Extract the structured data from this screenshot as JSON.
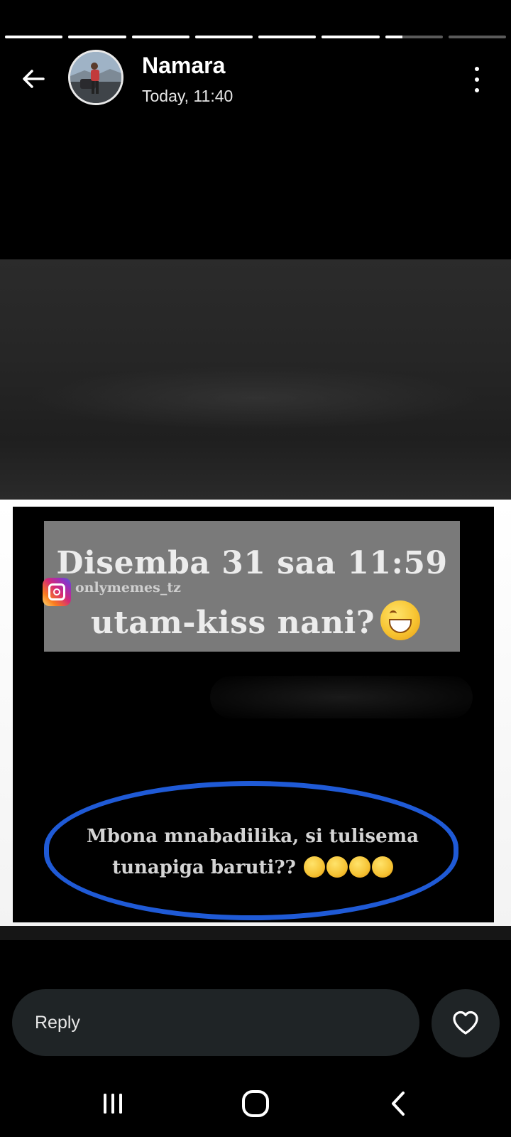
{
  "status": {
    "progress_segments": [
      1,
      1,
      1,
      1,
      1,
      1,
      0.3,
      0
    ]
  },
  "header": {
    "back_icon": "arrow-left-icon",
    "contact_name": "Namara",
    "timestamp": "Today, 11:40",
    "menu_icon": "more-vertical-icon"
  },
  "media": {
    "headline_line1": "Disemba 31 saa 11:59",
    "headline_line2": "utam-kiss nani?",
    "instagram_handle": "onlymemes_tz",
    "comment_line1": "Mbona mnabadilika, si tulisema",
    "comment_line2": "tunapiga baruti??",
    "comment_ring_color": "#1f5ad6"
  },
  "reply": {
    "placeholder": "Reply",
    "like_icon": "heart-icon"
  },
  "nav": {
    "recents_icon": "recents-icon",
    "home_icon": "home-icon",
    "back_icon": "back-chevron-icon"
  }
}
